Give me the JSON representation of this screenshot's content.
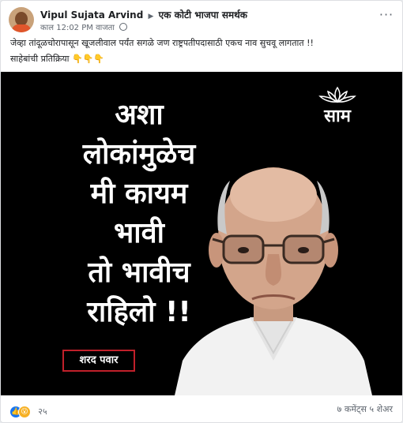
{
  "post": {
    "author": "Vipul Sujata Arvind",
    "group": "एक कोटी भाजपा समर्थक",
    "timestamp": "काल 12:02 PM वाजता",
    "text_line1": "जेव्हा तांदूळचोरापासून खूजलीवाल पर्यंत सगळे जण राष्ट्रपतीपदासाठी एकच नाव सुचवू लागतात !!",
    "text_line2": "साहेबांची प्रतिक्रिया",
    "text_emojis": "👇👇👇",
    "image": {
      "quote_lines": [
        "अशा",
        "लोकांमुळेच",
        "मी कायम",
        "भावी",
        "तो भावीच",
        "राहिलो !!"
      ],
      "logo_text": "साम",
      "caption": "शरद पवार"
    },
    "reactions": {
      "count": "२५",
      "icons": [
        "like-icon",
        "wow-icon"
      ]
    },
    "stats": "७ कमेंट्स ५ शेअर"
  }
}
